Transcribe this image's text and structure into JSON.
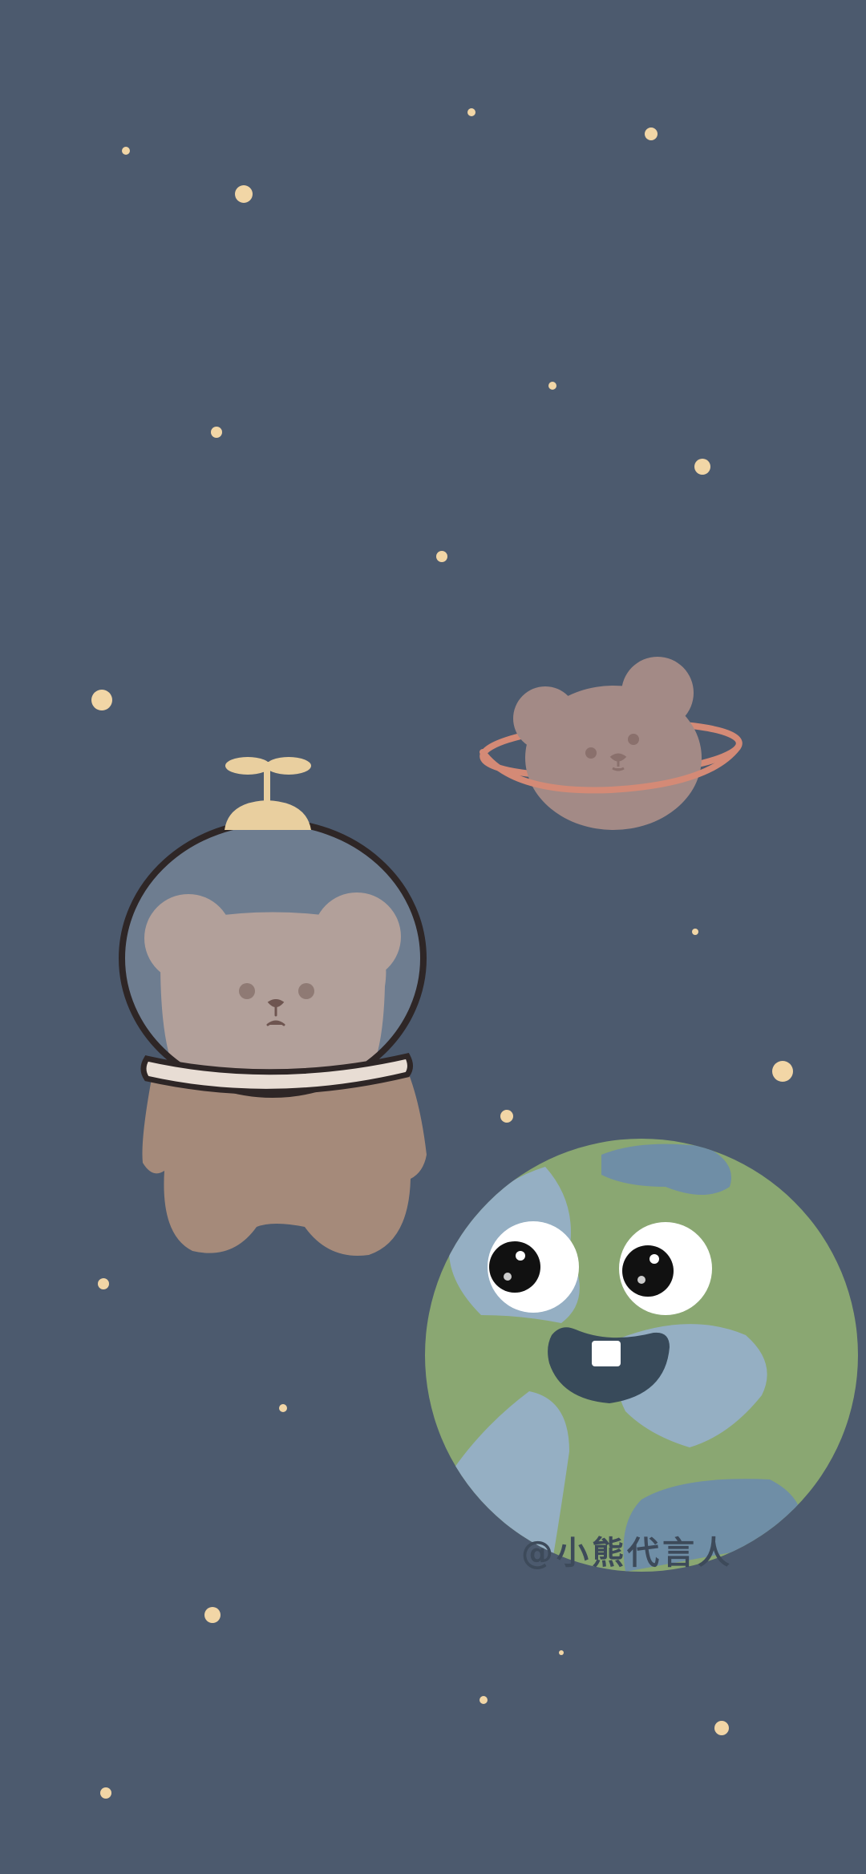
{
  "wallpaper": {
    "background_color": "#4c5a6e",
    "star_color": "#f2d6a6",
    "watermark": "@小熊代言人",
    "subjects": [
      "astronaut-bear",
      "bear-planet",
      "smiling-earth"
    ]
  },
  "colors": {
    "bear_body": "#a58a7a",
    "bear_head": "#b2a09a",
    "helmet_glass": "#6e7d90",
    "propeller": "#e9cf9f",
    "earth_land": "#8aa772",
    "earth_water": "#95afc3",
    "planet_ring": "#d48a76"
  }
}
